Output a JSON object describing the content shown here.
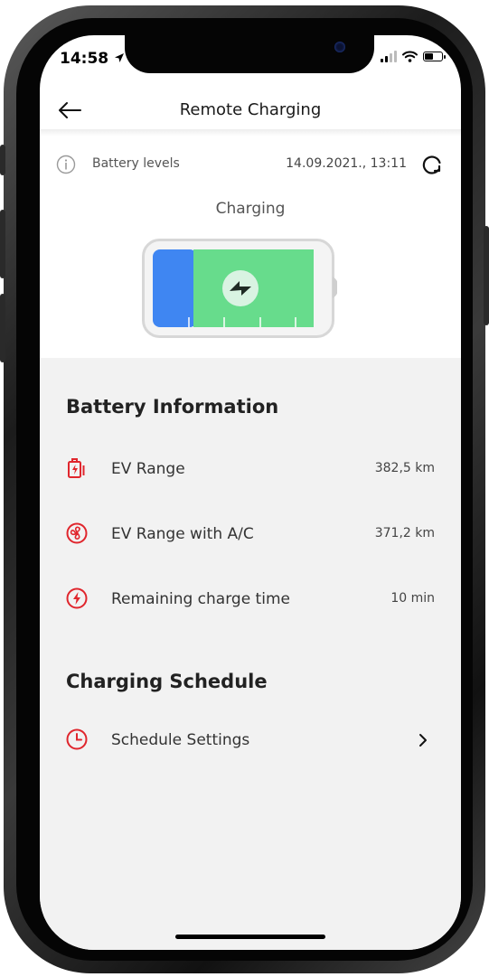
{
  "status_bar": {
    "time": "14:58"
  },
  "nav": {
    "title": "Remote Charging"
  },
  "battery_header": {
    "label": "Battery levels",
    "timestamp": "14.09.2021., 13:11"
  },
  "charging_status": "Charging",
  "battery_level": {
    "charged_fraction": 0.25
  },
  "battery_info": {
    "title": "Battery Information",
    "rows": [
      {
        "icon": "ev-station-icon",
        "label": "EV Range",
        "value": "382,5 km"
      },
      {
        "icon": "fan-icon",
        "label": "EV Range with A/C",
        "value": "371,2 km"
      },
      {
        "icon": "lightning-circle-icon",
        "label": "Remaining charge time",
        "value": "10 min"
      }
    ]
  },
  "charging_schedule": {
    "title": "Charging Schedule",
    "item": {
      "icon": "clock-icon",
      "label": "Schedule Settings"
    }
  },
  "colors": {
    "accent_red": "#e0262d",
    "battery_blue": "#3f86f2",
    "battery_green": "#67dc8c"
  }
}
